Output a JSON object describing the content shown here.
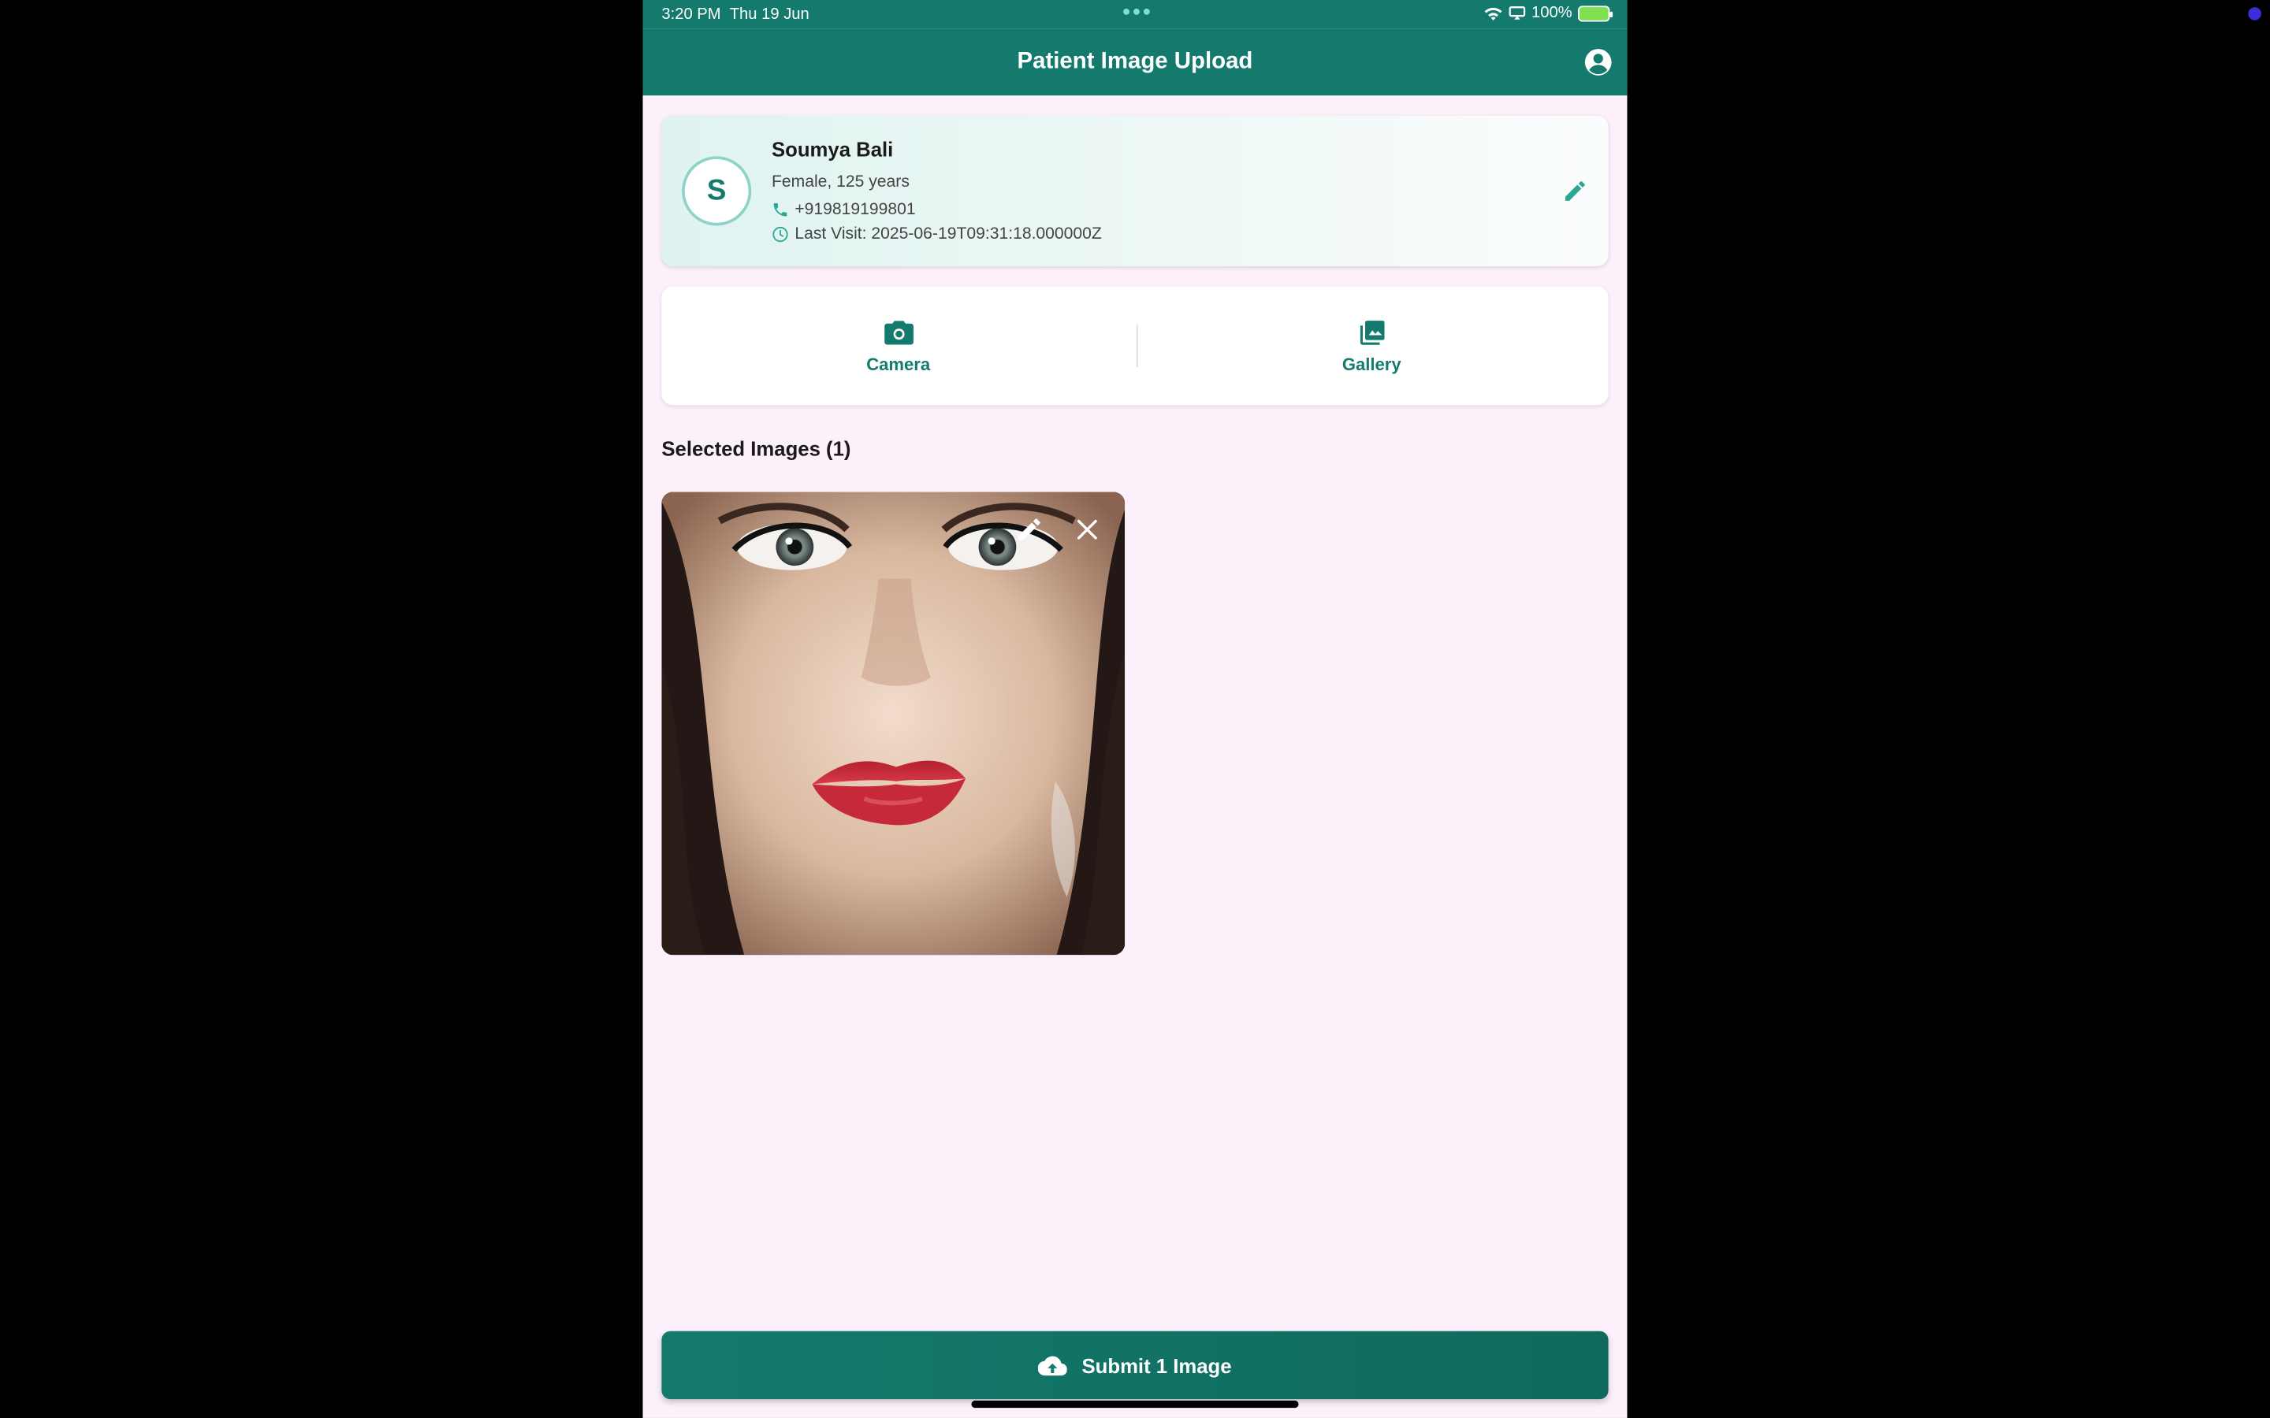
{
  "status_bar": {
    "time": "3:20 PM",
    "date": "Thu 19 Jun",
    "battery": "100%"
  },
  "app_bar": {
    "title": "Patient Image Upload",
    "account_icon": "account-circle-icon"
  },
  "patient": {
    "initial": "S",
    "name": "Soumya Bali",
    "info": "Female, 125 years",
    "phone": "+919819199801",
    "last_visit": "Last Visit: 2025-06-19T09:31:18.000000Z"
  },
  "sources": {
    "camera_label": "Camera",
    "gallery_label": "Gallery"
  },
  "selected": {
    "title": "Selected Images (1)"
  },
  "submit": {
    "label": "Submit 1 Image"
  },
  "colors": {
    "primary": "#137a6d",
    "background": "#fcf0fb"
  }
}
